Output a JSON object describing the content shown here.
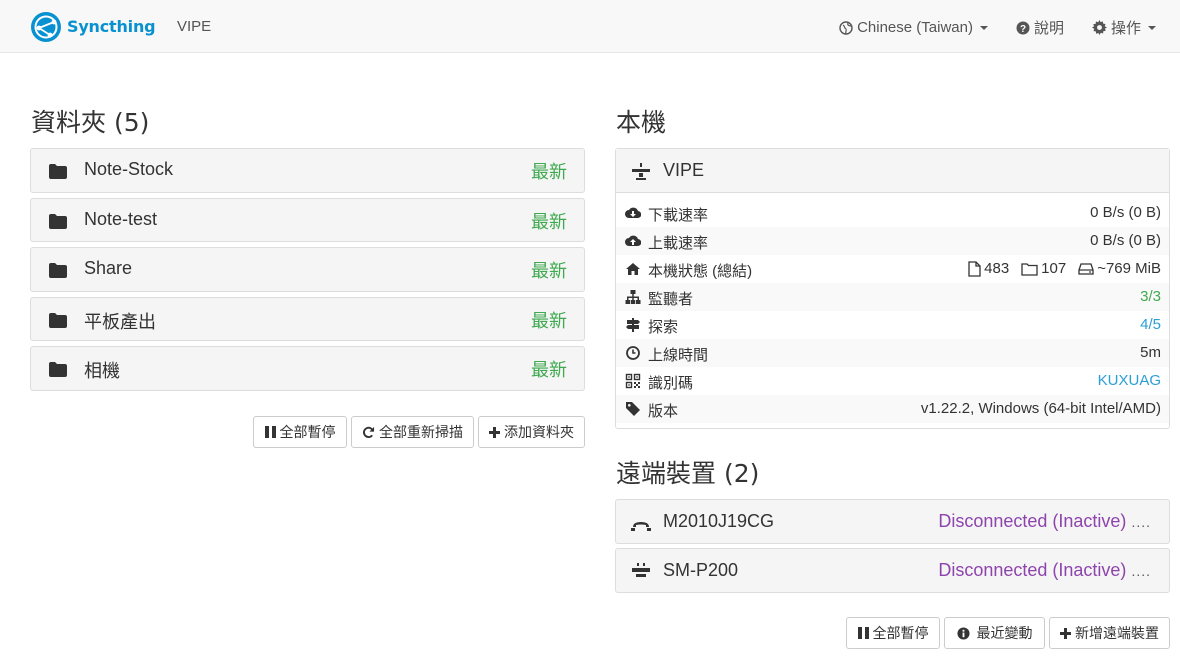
{
  "navbar": {
    "brand": "Syncthing",
    "device_name": "VIPE",
    "language": "Chinese (Taiwan)",
    "help": "說明",
    "actions": "操作"
  },
  "folders": {
    "heading": "資料夾 (5)",
    "items": [
      {
        "name": "Note-Stock",
        "status": "最新"
      },
      {
        "name": "Note-test",
        "status": "最新"
      },
      {
        "name": "Share",
        "status": "最新"
      },
      {
        "name": "平板產出",
        "status": "最新"
      },
      {
        "name": "相機",
        "status": "最新"
      }
    ],
    "buttons": {
      "pause_all": "全部暫停",
      "rescan_all": "全部重新掃描",
      "add_folder": "添加資料夾"
    }
  },
  "this_device": {
    "heading": "本機",
    "name": "VIPE",
    "rows": [
      {
        "label": "下載速率",
        "value": "0 B/s (0 B)"
      },
      {
        "label": "上載速率",
        "value": "0 B/s (0 B)"
      },
      {
        "label": "本機狀態 (總結)",
        "files": "483",
        "dirs": "107",
        "size": "~769 MiB"
      },
      {
        "label": "監聽者",
        "value": "3/3"
      },
      {
        "label": "探索",
        "value": "4/5"
      },
      {
        "label": "上線時間",
        "value": "5m"
      },
      {
        "label": "識別碼",
        "value": "KUXUAG"
      },
      {
        "label": "版本",
        "value": "v1.22.2, Windows (64-bit Intel/AMD)"
      }
    ]
  },
  "remote_devices": {
    "heading": "遠端裝置 (2)",
    "items": [
      {
        "name": "M2010J19CG",
        "status": "Disconnected (Inactive)"
      },
      {
        "name": "SM-P200",
        "status": "Disconnected (Inactive)"
      }
    ],
    "buttons": {
      "pause_all": "全部暫停",
      "recent_changes": "最近變動",
      "add_device": "新增遠端裝置"
    }
  },
  "colors": {
    "brand": "#0891d1",
    "up_to_date": "#3fa94f",
    "disconnected": "#8e44ad",
    "info": "#2a9fd6"
  }
}
